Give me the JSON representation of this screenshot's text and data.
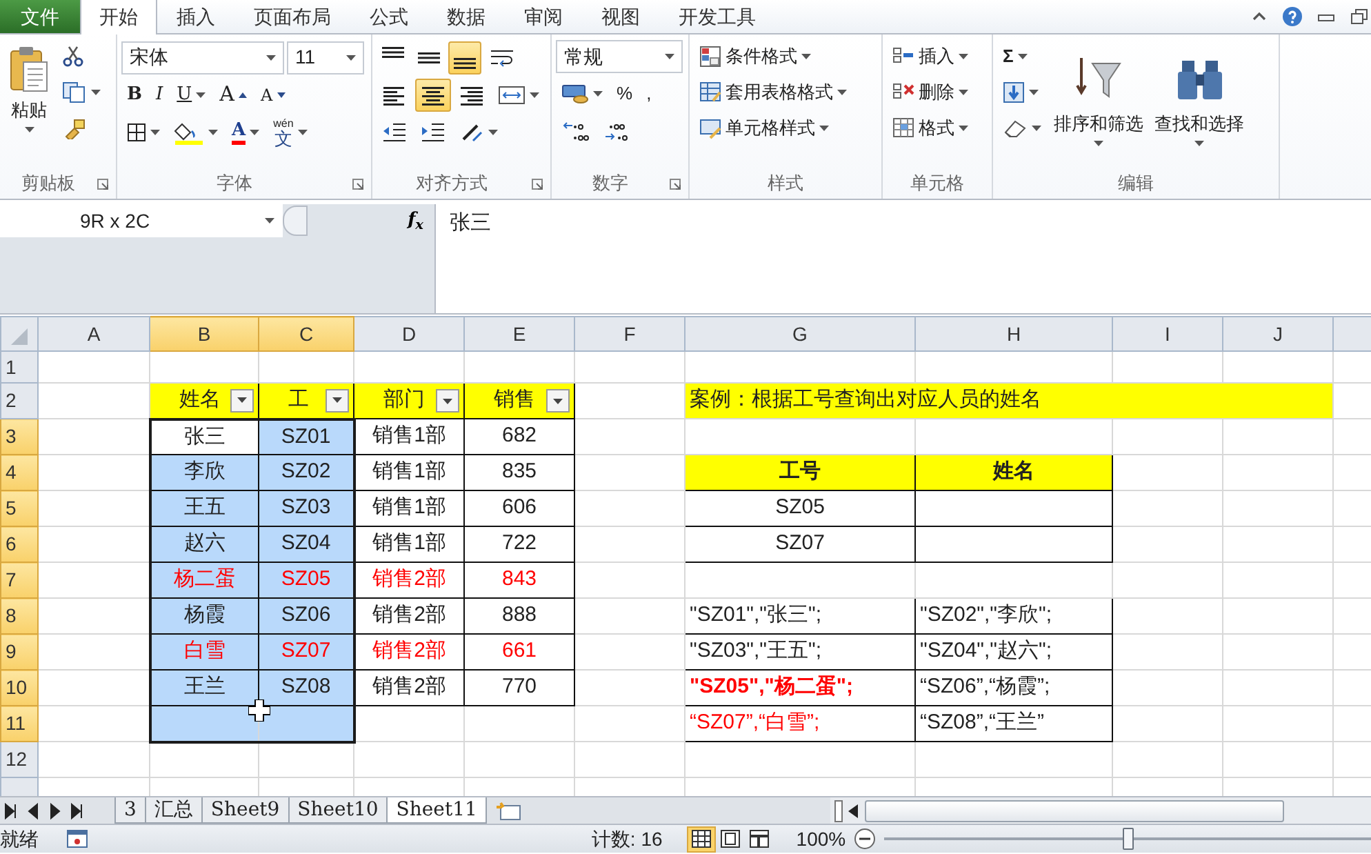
{
  "window": {
    "controls": [
      {
        "kind": "collapse"
      },
      {
        "kind": "help"
      },
      {
        "kind": "minimize"
      },
      {
        "kind": "restore"
      }
    ]
  },
  "ribbon": {
    "tabs": [
      {
        "label": "文件",
        "kind": "file",
        "selected": false
      },
      {
        "label": "开始",
        "kind": "tab",
        "selected": true
      },
      {
        "label": "插入",
        "kind": "tab",
        "selected": false
      },
      {
        "label": "页面布局",
        "kind": "tab",
        "selected": false
      },
      {
        "label": "公式",
        "kind": "tab",
        "selected": false
      },
      {
        "label": "数据",
        "kind": "tab",
        "selected": false
      },
      {
        "label": "审阅",
        "kind": "tab",
        "selected": false
      },
      {
        "label": "视图",
        "kind": "tab",
        "selected": false
      },
      {
        "label": "开发工具",
        "kind": "tab",
        "selected": false
      }
    ],
    "clipboard": {
      "paste": "粘贴",
      "label": "剪贴板"
    },
    "font": {
      "face": "宋体",
      "size": "11",
      "bold": "B",
      "italic": "I",
      "underline": "U",
      "grow": "A",
      "shrink": "A",
      "font_color": "A",
      "phonetic_ruby": "wén",
      "phonetic_char": "文",
      "label": "字体"
    },
    "alignment": {
      "buttons": [
        {
          "kind": "top",
          "selected": false
        },
        {
          "kind": "middle",
          "selected": false
        },
        {
          "kind": "bottom",
          "selected": true
        },
        {
          "kind": "left",
          "selected": false
        },
        {
          "kind": "center",
          "selected": true
        },
        {
          "kind": "right",
          "selected": false
        }
      ],
      "label": "对齐方式"
    },
    "number": {
      "format": "常规",
      "percent": "%",
      "comma": ",",
      "label": "数字"
    },
    "styles": {
      "items": [
        "条件格式",
        "套用表格格式",
        "单元格样式"
      ],
      "label": "样式"
    },
    "cells": {
      "items": [
        "插入",
        "删除",
        "格式"
      ],
      "label": "单元格"
    },
    "editing": {
      "sum": "Σ",
      "sort": "排序和筛选",
      "find": "查找和选择",
      "label": "编辑"
    }
  },
  "formula_bar": {
    "name_box": "9R x 2C",
    "fx": "f$_{x}$",
    "formula": "张三"
  },
  "sheet": {
    "column_headers": [
      {
        "label": "A",
        "selected": false
      },
      {
        "label": "B",
        "selected": true
      },
      {
        "label": "C",
        "selected": true
      },
      {
        "label": "D",
        "selected": false
      },
      {
        "label": "E",
        "selected": false
      },
      {
        "label": "F",
        "selected": false
      },
      {
        "label": "G",
        "selected": false
      },
      {
        "label": "H",
        "selected": false
      },
      {
        "label": "I",
        "selected": false
      },
      {
        "label": "J",
        "selected": false
      }
    ],
    "row_headers": [
      {
        "label": "1",
        "selected": false
      },
      {
        "label": "2",
        "selected": false
      },
      {
        "label": "3",
        "selected": true
      },
      {
        "label": "4",
        "selected": true
      },
      {
        "label": "5",
        "selected": true
      },
      {
        "label": "6",
        "selected": true
      },
      {
        "label": "7",
        "selected": true
      },
      {
        "label": "8",
        "selected": true
      },
      {
        "label": "9",
        "selected": true
      },
      {
        "label": "10",
        "selected": true
      },
      {
        "label": "11",
        "selected": true
      },
      {
        "label": "12",
        "selected": false
      }
    ],
    "sales_table": {
      "columns": [
        "姓名",
        "工",
        "部门",
        "销售"
      ],
      "rows": [
        {
          "name": "张三",
          "id": "SZ01",
          "dept": "销售1部",
          "amount": "682",
          "highlight": false
        },
        {
          "name": "李欣",
          "id": "SZ02",
          "dept": "销售1部",
          "amount": "835",
          "highlight": false
        },
        {
          "name": "王五",
          "id": "SZ03",
          "dept": "销售1部",
          "amount": "606",
          "highlight": false
        },
        {
          "name": "赵六",
          "id": "SZ04",
          "dept": "销售1部",
          "amount": "722",
          "highlight": false
        },
        {
          "name": "杨二蛋",
          "id": "SZ05",
          "dept": "销售2部",
          "amount": "843",
          "highlight": true
        },
        {
          "name": "杨霞",
          "id": "SZ06",
          "dept": "销售2部",
          "amount": "888",
          "highlight": false
        },
        {
          "name": "白雪",
          "id": "SZ07",
          "dept": "销售2部",
          "amount": "661",
          "highlight": true
        },
        {
          "name": "王兰",
          "id": "SZ08",
          "dept": "销售2部",
          "amount": "770",
          "highlight": false
        }
      ]
    },
    "title": "案例：根据工号查询出对应人员的姓名",
    "lookup_table": {
      "columns": [
        "工号",
        "姓名"
      ],
      "rows": [
        {
          "id": "SZ05"
        },
        {
          "id": "SZ07"
        }
      ]
    },
    "pairs": [
      {
        "text": "\"SZ01\",\"张三\";",
        "highlight": false,
        "bold": false
      },
      {
        "text": "\"SZ02\",\"李欣\";",
        "highlight": false,
        "bold": false
      },
      {
        "text": "\"SZ03\",\"王五\";",
        "highlight": false,
        "bold": false
      },
      {
        "text": "\"SZ04\",\"赵六\";",
        "highlight": false,
        "bold": false
      },
      {
        "text": "\"SZ05\",\"杨二蛋\";",
        "highlight": true,
        "bold": true
      },
      {
        "text": "“SZ06”,“杨霞”;",
        "highlight": false,
        "bold": false
      },
      {
        "text": "“SZ07”,“白雪”;",
        "highlight": true,
        "bold": false
      },
      {
        "text": "“SZ08”,“王兰”",
        "highlight": false,
        "bold": false
      }
    ]
  },
  "sheet_tabs": [
    {
      "label": "3",
      "selected": false
    },
    {
      "label": "汇总",
      "selected": false
    },
    {
      "label": "Sheet9",
      "selected": false
    },
    {
      "label": "Sheet10",
      "selected": false
    },
    {
      "label": "Sheet11",
      "selected": true
    }
  ],
  "status_bar": {
    "mode": "就绪",
    "count": "计数: 16",
    "views": [
      {
        "kind": "normal",
        "selected": true
      },
      {
        "kind": "layout",
        "selected": false
      },
      {
        "kind": "break",
        "selected": false
      }
    ],
    "zoom": "100%",
    "zoom_level": {
      "level": 0.5
    }
  }
}
